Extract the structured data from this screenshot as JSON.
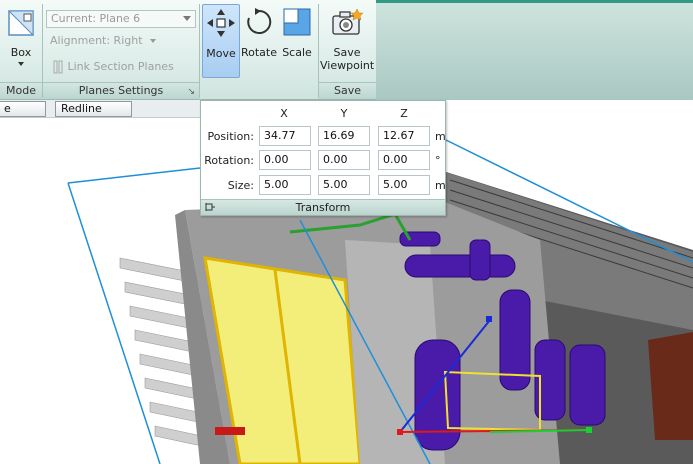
{
  "ribbon": {
    "mode": {
      "box_label": "Box",
      "group_label": "Mode"
    },
    "planes": {
      "current_plane": "Current: Plane 6",
      "alignment": "Alignment: Right",
      "link_section_planes": "Link Section Planes",
      "group_label": "Planes Settings"
    },
    "transform_tools": {
      "move_label": "Move",
      "rotate_label": "Rotate",
      "scale_label": "Scale"
    },
    "save": {
      "save_viewpoint_line1": "Save",
      "save_viewpoint_line2": "Viewpoint",
      "group_label": "Save"
    }
  },
  "toolstrip": {
    "left_tools_label": "e Tools",
    "redline_tools_label": "Redline Tools"
  },
  "transform_panel": {
    "headers": {
      "x": "X",
      "y": "Y",
      "z": "Z"
    },
    "position": {
      "label": "Position:",
      "x": "34.77",
      "y": "16.69",
      "z": "12.67",
      "unit": "m"
    },
    "rotation": {
      "label": "Rotation:",
      "x": "0.00",
      "y": "0.00",
      "z": "0.00",
      "unit": "°"
    },
    "size": {
      "label": "Size:",
      "x": "5.00",
      "y": "5.00",
      "z": "5.00",
      "unit": "m"
    },
    "footer_label": "Transform"
  },
  "colors": {
    "accent": "#2f9b84",
    "active_button": "#a8cdf1",
    "section_box": "#1e8fd8",
    "pipe": "#4a1aa8",
    "panel_yellow": "#f3ee7a"
  }
}
